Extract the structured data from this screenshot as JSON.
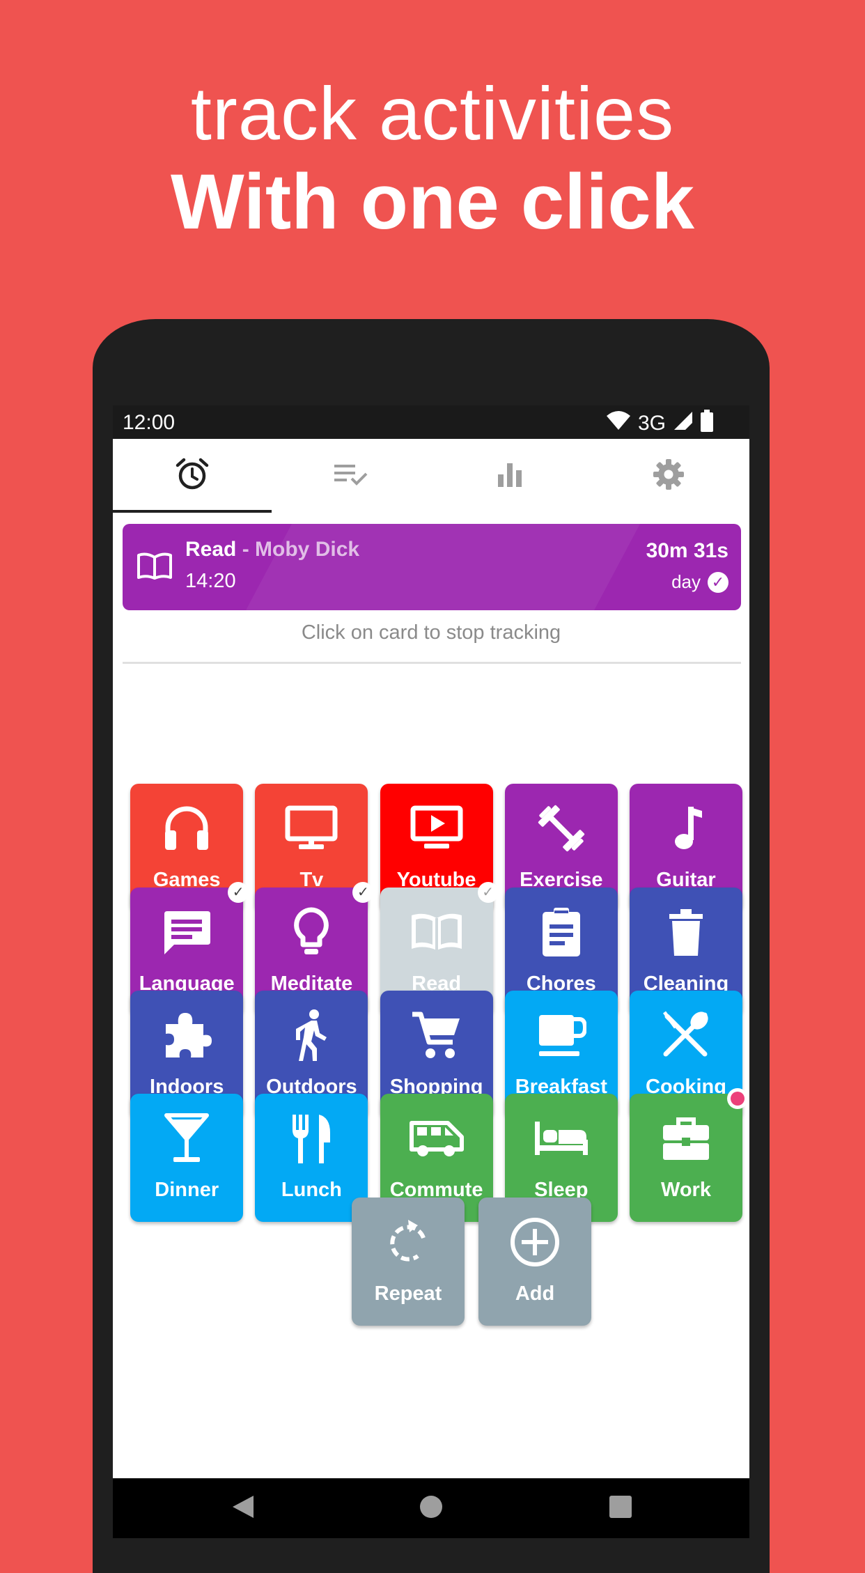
{
  "headline": {
    "line1": "track activities",
    "line2": "With one click"
  },
  "status_bar": {
    "time": "12:00",
    "network": "3G"
  },
  "tabs": [
    {
      "icon": "alarm-clock-icon",
      "active": true
    },
    {
      "icon": "checklist-icon",
      "active": false
    },
    {
      "icon": "bar-chart-icon",
      "active": false
    },
    {
      "icon": "gear-icon",
      "active": false
    }
  ],
  "tracker": {
    "icon": "book-icon",
    "activity": "Read",
    "separator": " - ",
    "subtitle": "Moby Dick",
    "start_time": "14:20",
    "duration": "30m 31s",
    "period": "day",
    "color": "#9C27B0"
  },
  "hint": "Click on card to stop tracking",
  "activities": [
    {
      "label": "Games",
      "icon": "headphones-icon",
      "color": "#F44336"
    },
    {
      "label": "Tv",
      "icon": "monitor-icon",
      "color": "#F44336"
    },
    {
      "label": "Youtube",
      "icon": "youtube-play-icon",
      "color": "#FF0000"
    },
    {
      "label": "Exercise",
      "icon": "dumbbell-icon",
      "color": "#9C27B0"
    },
    {
      "label": "Guitar",
      "icon": "music-note-icon",
      "color": "#9C27B0"
    },
    {
      "label": "Language",
      "icon": "chat-bubble-icon",
      "color": "#9C27B0",
      "checked": true
    },
    {
      "label": "Meditate",
      "icon": "lightbulb-icon",
      "color": "#9C27B0",
      "checked": true
    },
    {
      "label": "Read",
      "icon": "book-icon",
      "color": "#CFD8DC",
      "checked": true,
      "active": true
    },
    {
      "label": "Chores",
      "icon": "clipboard-icon",
      "color": "#3F51B5"
    },
    {
      "label": "Cleaning",
      "icon": "trash-icon",
      "color": "#3F51B5"
    },
    {
      "label": "Indoors",
      "icon": "puzzle-icon",
      "color": "#3F51B5"
    },
    {
      "label": "Outdoors",
      "icon": "walking-person-icon",
      "color": "#3F51B5"
    },
    {
      "label": "Shopping",
      "icon": "shopping-cart-icon",
      "color": "#3F51B5"
    },
    {
      "label": "Breakfast",
      "icon": "coffee-cup-icon",
      "color": "#03A9F4"
    },
    {
      "label": "Cooking",
      "icon": "utensils-crossed-icon",
      "color": "#03A9F4"
    },
    {
      "label": "Dinner",
      "icon": "cocktail-glass-icon",
      "color": "#03A9F4"
    },
    {
      "label": "Lunch",
      "icon": "fork-knife-icon",
      "color": "#03A9F4"
    },
    {
      "label": "Commute",
      "icon": "van-icon",
      "color": "#4CAF50"
    },
    {
      "label": "Sleep",
      "icon": "bed-icon",
      "color": "#4CAF50"
    },
    {
      "label": "Work",
      "icon": "briefcase-icon",
      "color": "#4CAF50",
      "notification": true
    }
  ],
  "actions": [
    {
      "label": "Repeat",
      "icon": "repeat-icon",
      "color": "#90A4AE"
    },
    {
      "label": "Add",
      "icon": "add-circle-icon",
      "color": "#90A4AE"
    }
  ],
  "nav": [
    {
      "icon": "back-triangle-icon"
    },
    {
      "icon": "home-circle-icon"
    },
    {
      "icon": "recents-square-icon"
    }
  ]
}
